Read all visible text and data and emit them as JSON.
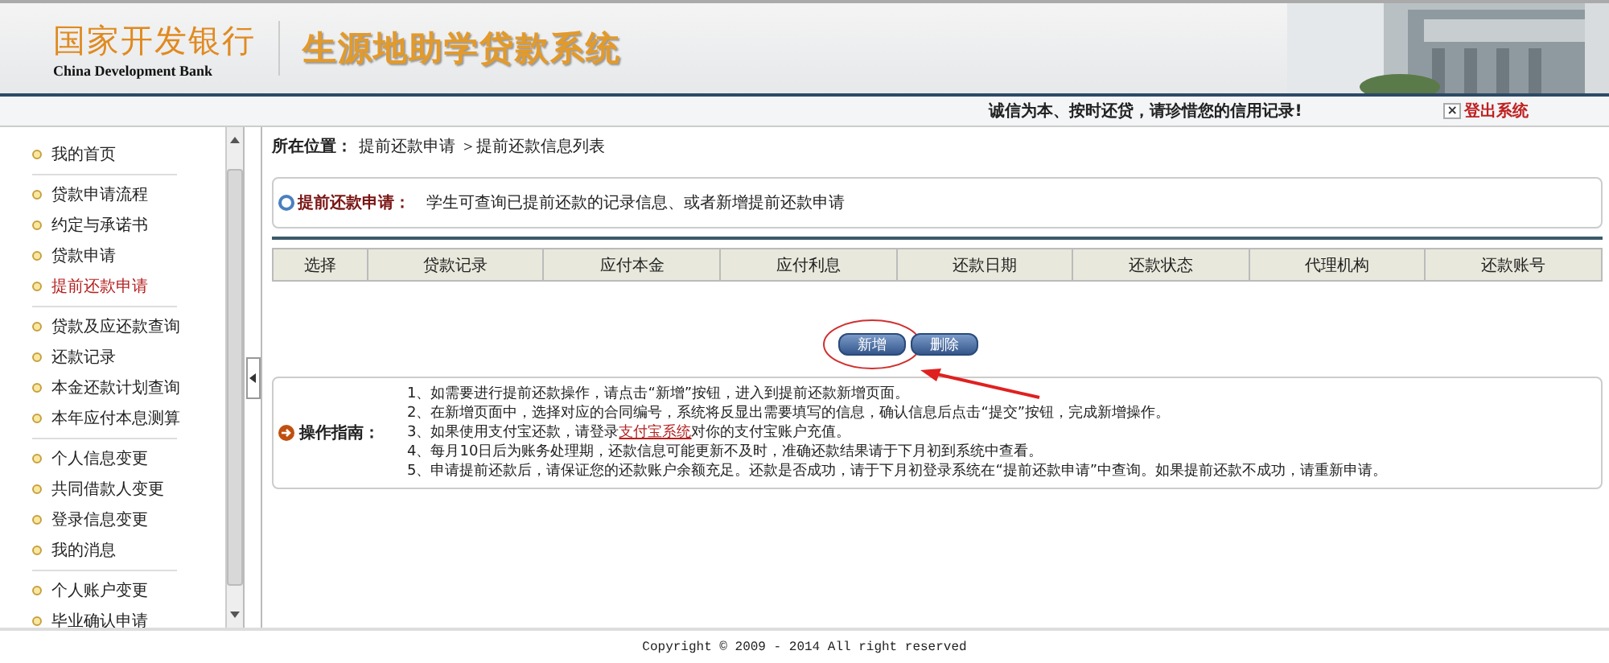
{
  "header": {
    "bank_name": "国家开发银行",
    "bank_name_en": "China Development Bank",
    "system_title": "生源地助学贷款系统",
    "kind": "picture"
  },
  "top_bar": {
    "slogan": "诚信为本、按时还贷，请珍惜您的信用记录!",
    "logout_icon": "×",
    "logout": "登出系统"
  },
  "sidebar": {
    "groups": [
      [
        {
          "label": "我的首页",
          "selected": false
        }
      ],
      [
        {
          "label": "贷款申请流程",
          "selected": false
        },
        {
          "label": "约定与承诺书",
          "selected": false
        },
        {
          "label": "贷款申请",
          "selected": false
        },
        {
          "label": "提前还款申请",
          "selected": true
        }
      ],
      [
        {
          "label": "贷款及应还款查询",
          "selected": false
        },
        {
          "label": "还款记录",
          "selected": false
        },
        {
          "label": "本金还款计划查询",
          "selected": false
        },
        {
          "label": "本年应付本息测算",
          "selected": false
        }
      ],
      [
        {
          "label": "个人信息变更",
          "selected": false
        },
        {
          "label": "共同借款人变更",
          "selected": false
        },
        {
          "label": "登录信息变更",
          "selected": false
        },
        {
          "label": "我的消息",
          "selected": false
        }
      ],
      [
        {
          "label": "个人账户变更",
          "selected": false
        },
        {
          "label": "毕业确认申请",
          "selected": false
        }
      ]
    ]
  },
  "breadcrumb": {
    "label": "所在位置：",
    "path": "提前还款申请 ＞提前还款信息列表"
  },
  "info": {
    "title": "提前还款申请：",
    "text": "学生可查询已提前还款的记录信息、或者新增提前还款申请"
  },
  "table": {
    "columns": [
      "选择",
      "贷款记录",
      "应付本金",
      "应付利息",
      "还款日期",
      "还款状态",
      "代理机构",
      "还款账号"
    ]
  },
  "buttons": [
    {
      "label": "新增",
      "highlighted": true
    },
    {
      "label": "删除",
      "highlighted": false
    }
  ],
  "guide": {
    "title": "操作指南：",
    "lines": [
      [
        {
          "text": "1、如需要进行提前还款操作，请点击“新增”按钮，进入到提前还款新增页面。"
        }
      ],
      [
        {
          "text": "2、在新增页面中，选择对应的合同编号，系统将反显出需要填写的信息，确认信息后点击“提交”按钮，完成新增操作。"
        }
      ],
      [
        {
          "text": "3、如果使用支付宝还款，请登录"
        },
        {
          "text": "支付宝系统",
          "kind": "link"
        },
        {
          "text": "对你的支付宝账户充值。"
        }
      ],
      [
        {
          "text": "4、每月10日后为账务处理期，还款信息可能更新不及时，准确还款结果请于下月初到系统中查看。"
        }
      ],
      [
        {
          "text": "5、申请提前还款后，请保证您的还款账户余额充足。还款是否成功，请于下月初登录系统在“提前还款申请”中查询。如果提前还款不成功，请重新申请。"
        }
      ]
    ]
  },
  "footer": {
    "copyright": "Copyright © 2009 - 2014 All right reserved"
  }
}
